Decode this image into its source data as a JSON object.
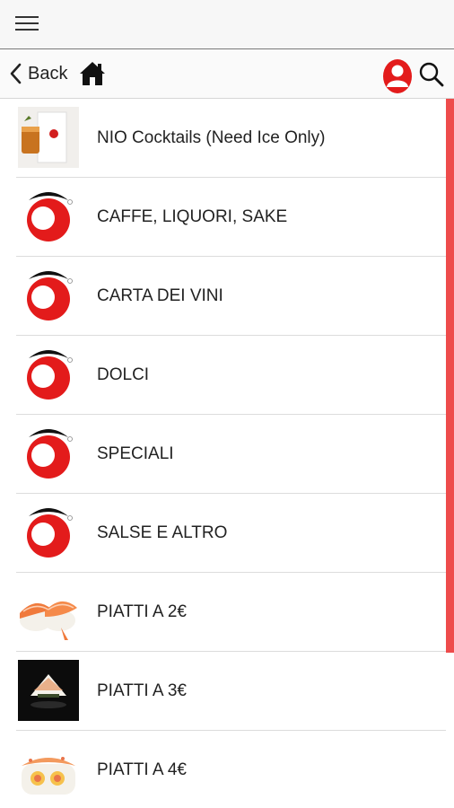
{
  "nav": {
    "back_label": "Back"
  },
  "icons": {
    "menu": "hamburger-icon",
    "back": "chevron-left-icon",
    "home": "home-icon",
    "user": "user-icon",
    "search": "search-icon"
  },
  "colors": {
    "accent": "#e31b1b",
    "scrollbar": "#ee4b4b"
  },
  "scroll": {
    "visible_fraction": 0.78
  },
  "items": [
    {
      "label": "NIO Cocktails (Need Ice Only)",
      "thumb": "cocktail-photo"
    },
    {
      "label": "CAFFE, LIQUORI, SAKE",
      "thumb": "brand-logo"
    },
    {
      "label": "CARTA DEI VINI",
      "thumb": "brand-logo"
    },
    {
      "label": "DOLCI",
      "thumb": "brand-logo"
    },
    {
      "label": "SPECIALI",
      "thumb": "brand-logo"
    },
    {
      "label": "SALSE E ALTRO",
      "thumb": "brand-logo"
    },
    {
      "label": "PIATTI A 2€",
      "thumb": "nigiri-photo"
    },
    {
      "label": "PIATTI A 3€",
      "thumb": "sushi-dark-photo"
    },
    {
      "label": "PIATTI A 4€",
      "thumb": "roll-photo"
    }
  ]
}
